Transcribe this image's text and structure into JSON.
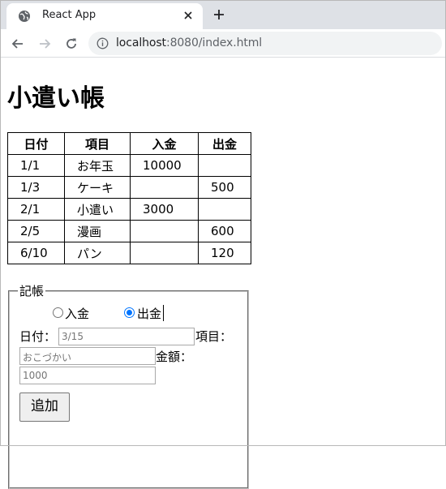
{
  "browser": {
    "tab_title": "React App",
    "url_host": "localhost",
    "url_rest": ":8080/index.html"
  },
  "page": {
    "heading": "小遣い帳",
    "table": {
      "headers": [
        "日付",
        "項目",
        "入金",
        "出金"
      ],
      "rows": [
        [
          "1/1",
          "お年玉",
          "10000",
          ""
        ],
        [
          "1/3",
          "ケーキ",
          "",
          "500"
        ],
        [
          "2/1",
          "小遣い",
          "3000",
          ""
        ],
        [
          "2/5",
          "漫画",
          "",
          "600"
        ],
        [
          "6/10",
          "パン",
          "",
          "120"
        ]
      ]
    },
    "form": {
      "legend": "記帳",
      "radio_income_label": "入金",
      "radio_expense_label": "出金",
      "selected": "出金",
      "date_label": "日付：",
      "date_placeholder": "3/15",
      "item_label": "項目：",
      "item_placeholder": "おこづかい",
      "amount_label": "金額：",
      "amount_placeholder": "1000",
      "add_button": "追加"
    }
  }
}
